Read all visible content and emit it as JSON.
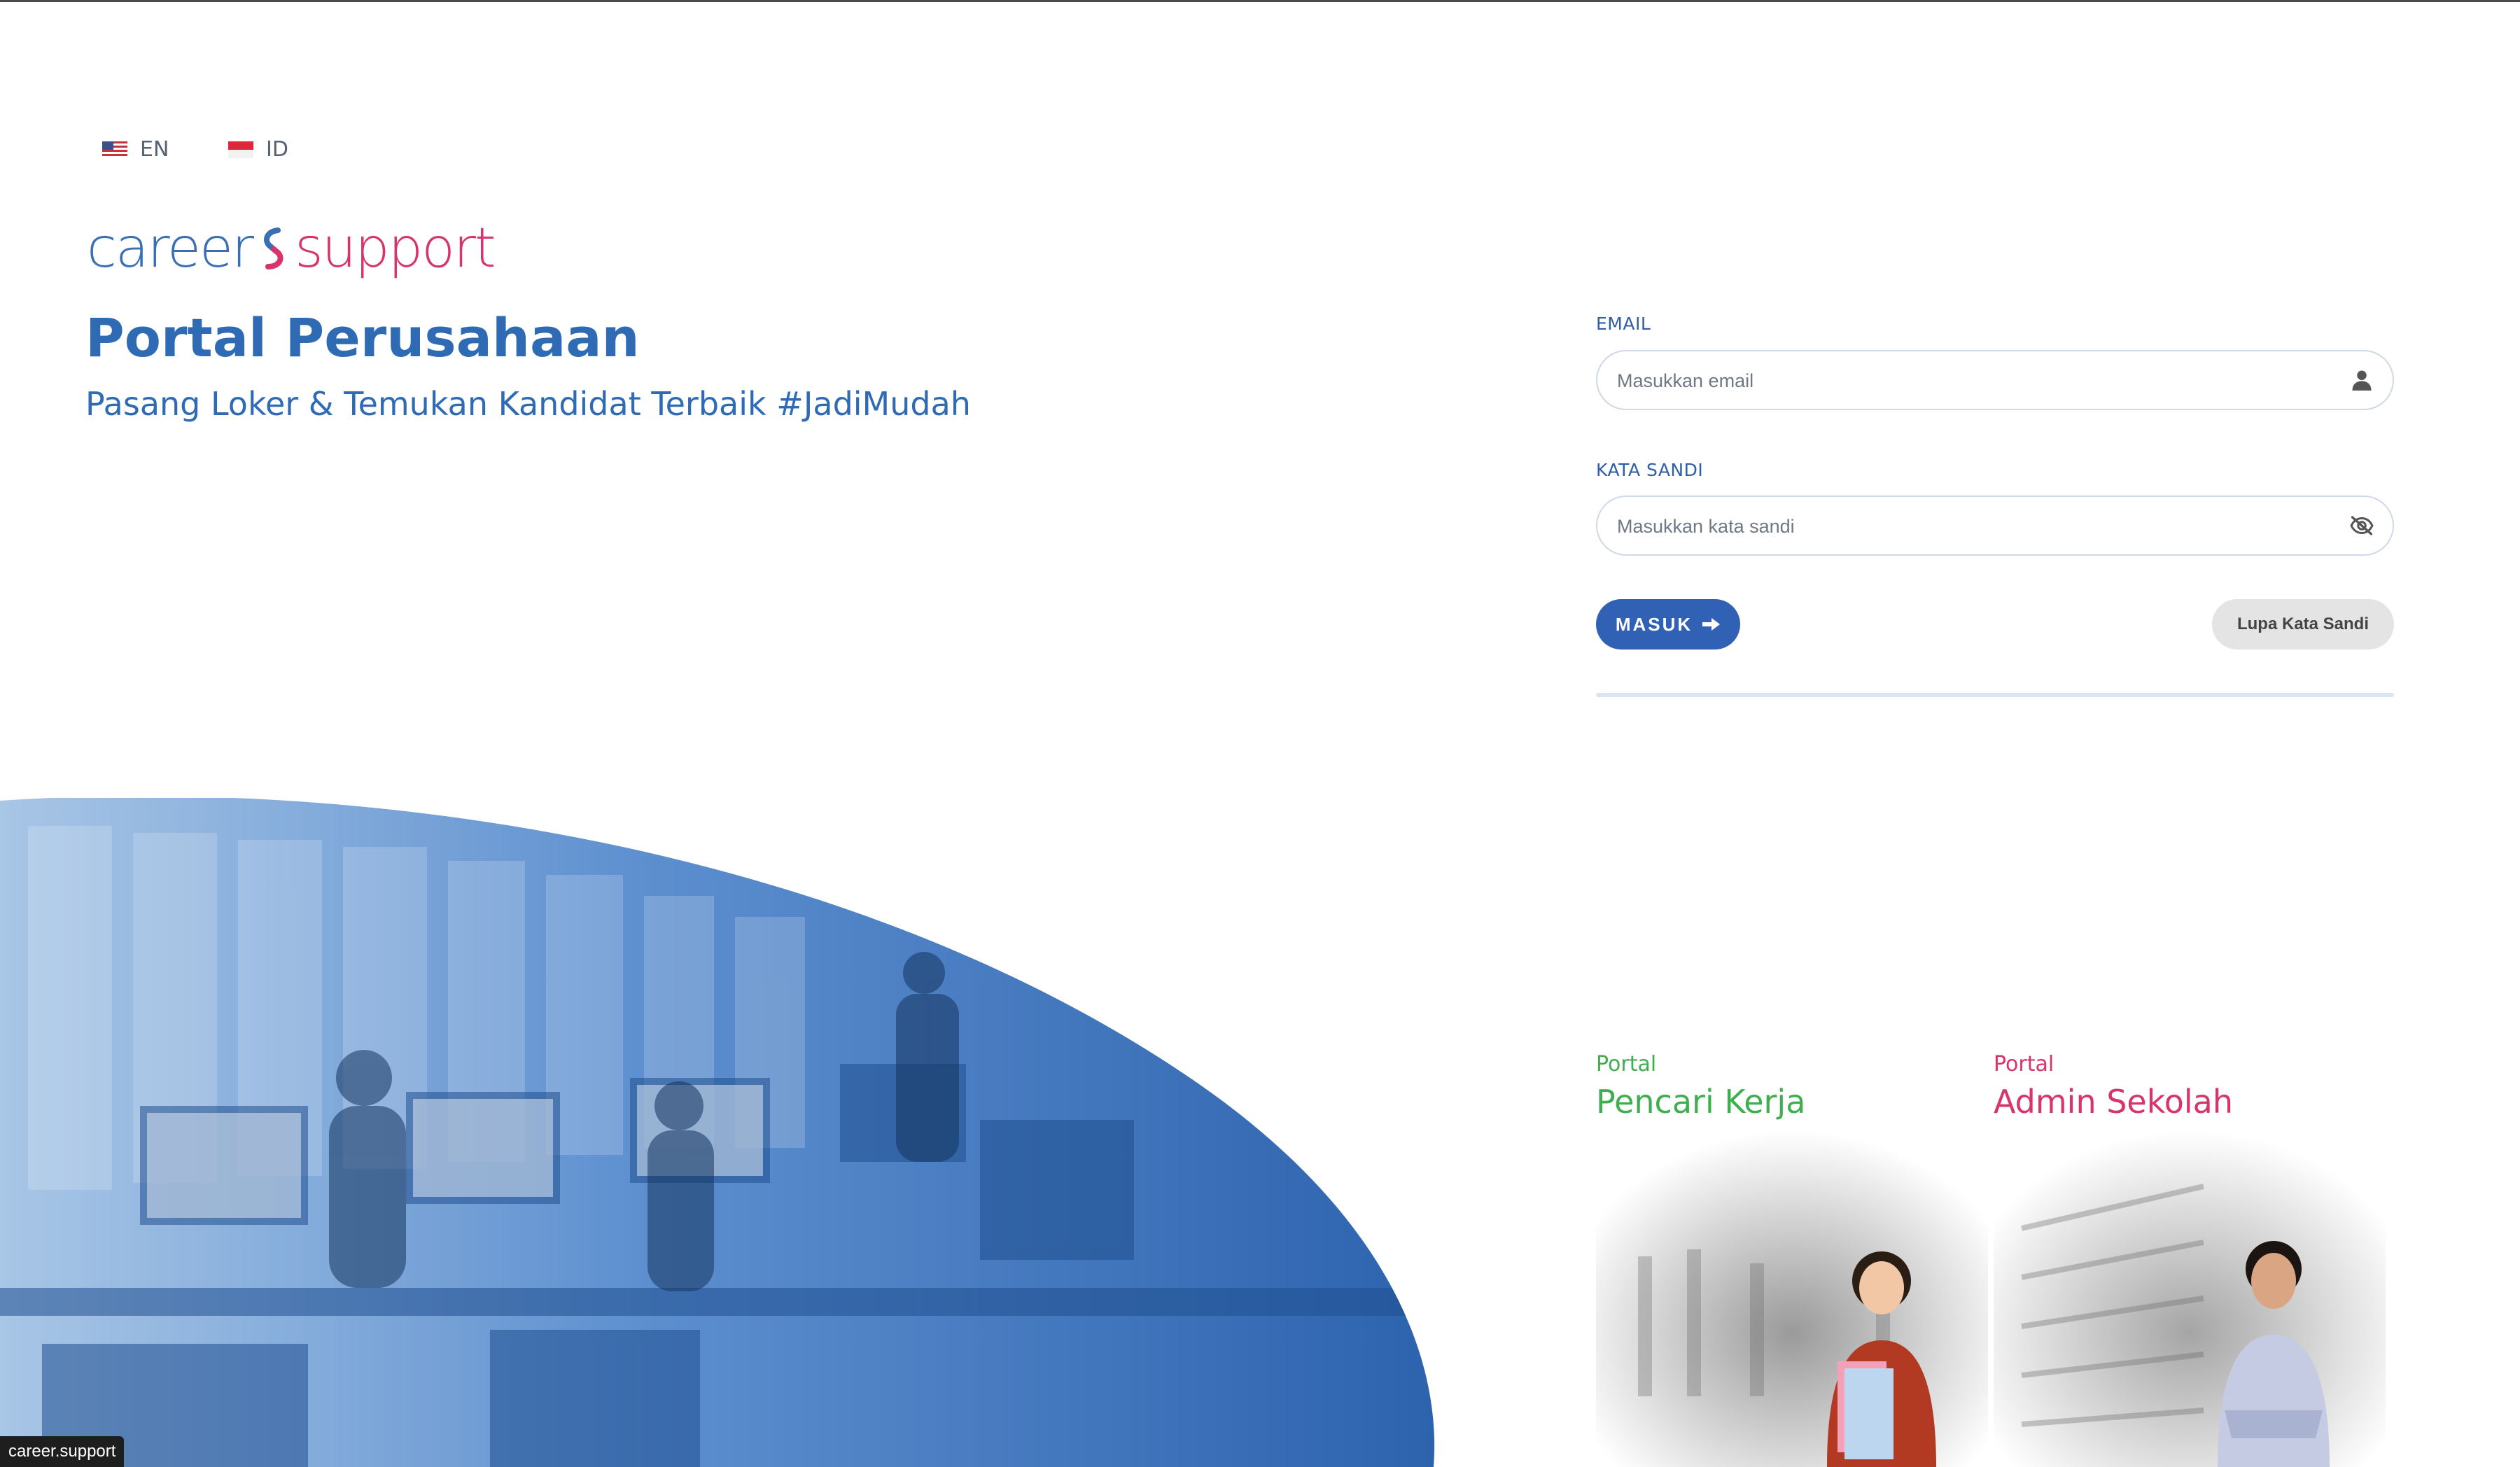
{
  "language": {
    "en": {
      "label": "EN",
      "icon": "us-flag-icon"
    },
    "id": {
      "label": "ID",
      "icon": "indonesia-flag-icon"
    }
  },
  "logo": {
    "career": "career",
    "support": "support",
    "icon": "career-support-logo-mark"
  },
  "hero": {
    "title": "Portal Perusahaan",
    "subtitle": "Pasang Loker & Temukan Kandidat Terbaik #JadiMudah"
  },
  "form": {
    "email": {
      "label": "EMAIL",
      "placeholder": "Masukkan email",
      "icon": "user-icon"
    },
    "password": {
      "label": "KATA SANDI",
      "placeholder": "Masukkan kata sandi",
      "icon": "eye-off-icon"
    },
    "login_label": "MASUK",
    "login_icon": "arrow-right-icon",
    "forgot_label": "Lupa Kata Sandi"
  },
  "portals": [
    {
      "small": "Portal",
      "big": "Pencari Kerja",
      "color": "#3fae4f"
    },
    {
      "small": "Portal",
      "big": "Admin Sekolah",
      "color": "#d9336c"
    }
  ],
  "footer_tag": "career.support",
  "colors": {
    "primary": "#3061b4",
    "accent_pink": "#d9336c",
    "accent_green": "#3fae4f"
  }
}
